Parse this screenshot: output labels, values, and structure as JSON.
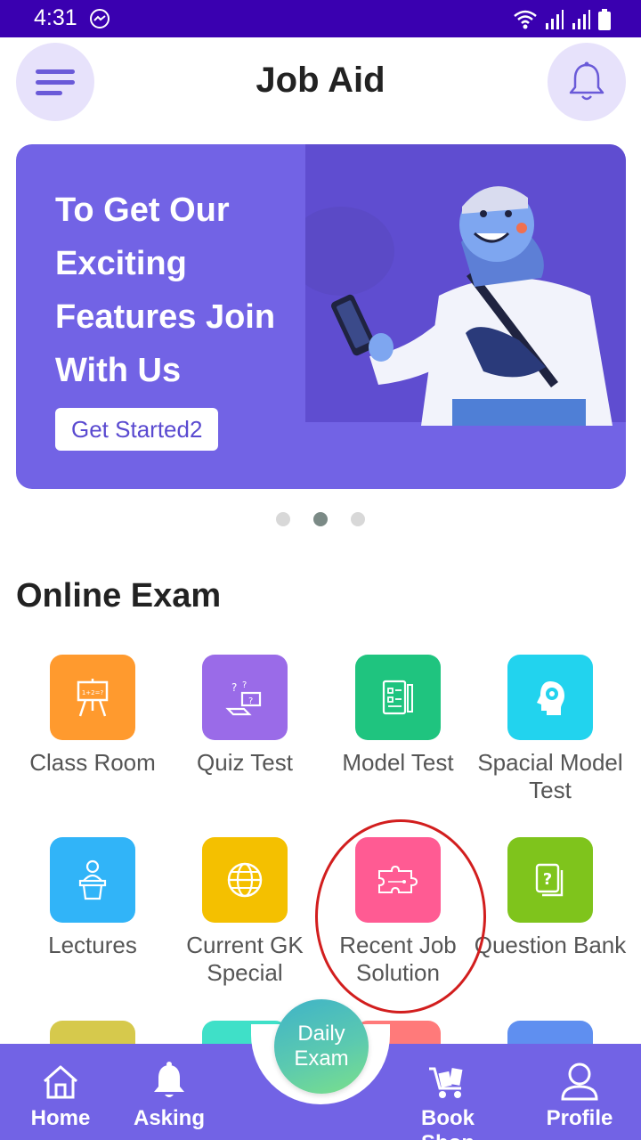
{
  "status_bar": {
    "time": "4:31"
  },
  "header": {
    "title": "Job Aid"
  },
  "banner": {
    "headline": "To Get Our Exciting Features Join With Us",
    "cta_label": "Get Started2"
  },
  "carousel": {
    "total_slides": 3,
    "active_index": 1
  },
  "section": {
    "title": "Online Exam"
  },
  "tiles": [
    {
      "label": "Class Room",
      "color": "#ff9a2e",
      "icon": "easel-icon"
    },
    {
      "label": "Quiz Test",
      "color": "#9a6be8",
      "icon": "quiz-icon"
    },
    {
      "label": "Model Test",
      "color": "#1fc47f",
      "icon": "document-icon"
    },
    {
      "label": "Spacial Model Test",
      "color": "#22d3ee",
      "icon": "brain-head-icon"
    },
    {
      "label": "Lectures",
      "color": "#31b4f8",
      "icon": "lecturer-icon"
    },
    {
      "label": "Current GK Special",
      "color": "#f4c000",
      "icon": "globe-icon"
    },
    {
      "label": "Recent Job Solution",
      "color": "#ff5b93",
      "icon": "puzzle-icon"
    },
    {
      "label": "Question Bank",
      "color": "#7fc41c",
      "icon": "question-book-icon"
    }
  ],
  "partial_tiles": [
    "#d6c94c",
    "#3fe0c8",
    "#ff7a7a",
    "#5f8ff0"
  ],
  "bottom_nav": {
    "home": "Home",
    "asking": "Asking",
    "fab_line1": "Daily",
    "fab_line2": "Exam",
    "book_shop": "Book Shop",
    "profile": "Profile"
  }
}
